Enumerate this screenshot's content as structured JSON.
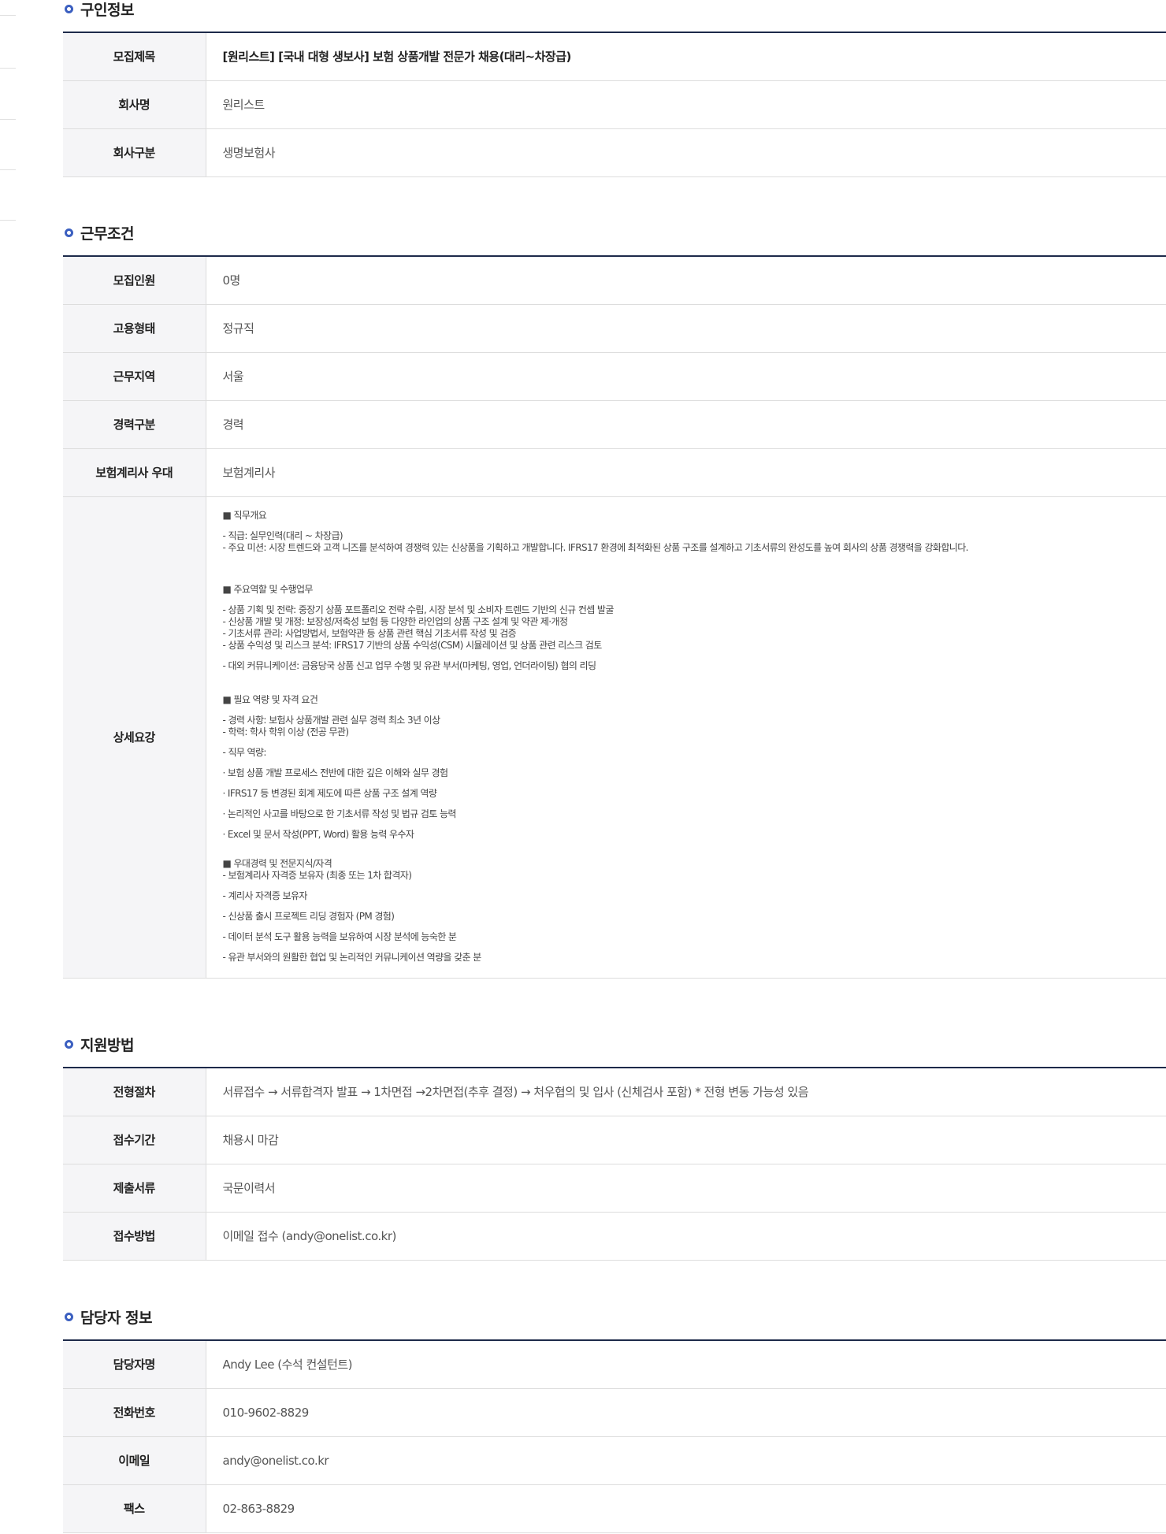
{
  "sections": {
    "recruit": {
      "title": "구인정보",
      "rows": [
        {
          "label": "모집제목",
          "value": "[원리스트] [국내 대형 생보사] 보험 상품개발 전문가 채용(대리~차장급)"
        },
        {
          "label": "회사명",
          "value": "원리스트"
        },
        {
          "label": "회사구분",
          "value": "생명보험사"
        }
      ]
    },
    "conditions": {
      "title": "근무조건",
      "rows": [
        {
          "label": "모집인원",
          "value": "0명"
        },
        {
          "label": "고용형태",
          "value": "정규직"
        },
        {
          "label": "근무지역",
          "value": "서울"
        },
        {
          "label": "경력구분",
          "value": "경력"
        },
        {
          "label": "보험계리사 우대",
          "value": "보험계리사"
        }
      ],
      "detail_label": "상세요강",
      "detail_lines": [
        "■ 직무개요",
        "- 직급: 실무인력(대리 ~ 차장급)",
        "- 주요 미션: 시장 트렌드와 고객 니즈를 분석하여 경쟁력 있는 신상품을 기획하고 개발합니다. IFRS17 환경에 최적화된 상품 구조를 설계하고 기초서류의 완성도를 높여 회사의 상품 경쟁력을 강화합니다.",
        "■ 주요역할 및 수행업무",
        "- 상품 기획 및 전략: 중장기 상품 포트폴리오 전략 수립, 시장 분석 및 소비자 트렌드 기반의 신규 컨셉 발굴",
        "- 신상품 개발 및 개정: 보장성/저축성 보험 등 다양한 라인업의 상품 구조 설계 및 약관 제·개정",
        "- 기초서류 관리: 사업방법서, 보험약관 등 상품 관련 핵심 기초서류 작성 및 검증",
        "- 상품 수익성 및 리스크 분석: IFRS17 기반의 상품 수익성(CSM) 시뮬레이션 및 상품 관련 리스크 검토",
        "- 대외 커뮤니케이션: 금융당국 상품 신고 업무 수행 및 유관 부서(마케팅, 영업, 언더라이팅) 협의 리딩",
        "■ 필요 역량 및 자격 요건",
        "- 경력 사항: 보험사 상품개발 관련 실무 경력 최소 3년 이상",
        "- 학력: 학사 학위 이상 (전공 무관)",
        "- 직무 역량:",
        " · 보험 상품 개발 프로세스 전반에 대한 깊은 이해와 실무 경험",
        "  · IFRS17 등 변경된 회계 제도에 따른 상품 구조 설계 역량",
        "  · 논리적인 사고를 바탕으로 한 기초서류 작성 및 법규 검토 능력",
        "  · Excel 및 문서 작성(PPT, Word) 활용 능력 우수자",
        "■ 우대경력 및 전문지식/자격",
        "- 보험계리사 자격증 보유자 (최종 또는 1차 합격자)",
        "- 계리사 자격증 보유자",
        "- 신상품 출시 프로젝트 리딩 경험자 (PM 경험)",
        "- 데이터 분석 도구 활용 능력을 보유하여 시장 분석에 능숙한 분",
        "- 유관 부서와의 원활한 협업 및 논리적인 커뮤니케이션 역량을 갖춘 분"
      ]
    },
    "apply": {
      "title": "지원방법",
      "rows": [
        {
          "label": "전형절차",
          "value": "서류접수 → 서류합격자 발표 → 1차면접 →2차면접(추후 결정) → 처우협의 및 입사 (신체검사 포함) * 전형 변동 가능성 있음"
        },
        {
          "label": "접수기간",
          "value": "채용시 마감"
        },
        {
          "label": "제출서류",
          "value": "국문이력서"
        },
        {
          "label": "접수방법",
          "value": "이메일 접수 (andy@onelist.co.kr)"
        }
      ]
    },
    "contact": {
      "title": "담당자 정보",
      "rows": [
        {
          "label": "담당자명",
          "value": "Andy Lee (수석 컨설턴트)"
        },
        {
          "label": "전화번호",
          "value": "010-9602-8829"
        },
        {
          "label": "이메일",
          "value": "andy@onelist.co.kr"
        },
        {
          "label": "팩스",
          "value": "02-863-8829"
        }
      ]
    }
  },
  "colors": {
    "accent": "#3b5fc0",
    "table_top_border": "#1d2a4a",
    "header_bg": "#f5f5f7"
  }
}
